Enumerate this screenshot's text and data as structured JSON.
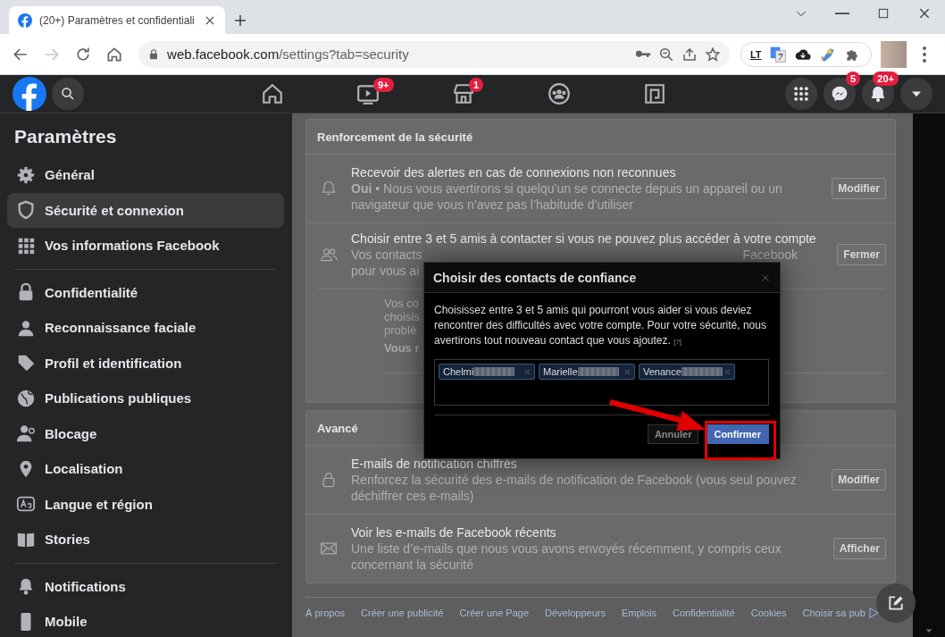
{
  "browser": {
    "tab": {
      "title": "(20+) Paramètres et confidentiali",
      "selected": true
    },
    "url": {
      "host": "web.facebook.com",
      "path": "/settings?tab=security"
    },
    "forward_disabled": true,
    "extensions": [
      {
        "kind": "languagetool",
        "label": "LT"
      },
      {
        "kind": "translate"
      },
      {
        "kind": "cloud"
      },
      {
        "kind": "rocket"
      },
      {
        "kind": "puzzle"
      }
    ]
  },
  "nav": {
    "center": [
      {
        "kind": "home"
      },
      {
        "kind": "watch",
        "badge": "9+"
      },
      {
        "kind": "marketplace",
        "badge": "1"
      },
      {
        "kind": "groups"
      },
      {
        "kind": "gaming"
      }
    ],
    "right": [
      {
        "kind": "apps"
      },
      {
        "kind": "messenger",
        "badge": "5"
      },
      {
        "kind": "notifications",
        "badge": "20+"
      },
      {
        "kind": "account"
      }
    ]
  },
  "sidebar": {
    "title": "Paramètres",
    "groups": [
      [
        {
          "kind": "gear",
          "label": "Général",
          "selected": false
        },
        {
          "kind": "shield",
          "label": "Sécurité et connexion",
          "selected": true
        },
        {
          "kind": "grid",
          "label": "Vos informations Facebook",
          "selected": false
        }
      ],
      [
        {
          "kind": "lock",
          "label": "Confidentialité",
          "selected": false
        },
        {
          "kind": "face",
          "label": "Reconnaissance faciale",
          "selected": false
        },
        {
          "kind": "tag",
          "label": "Profil et identification",
          "selected": false
        },
        {
          "kind": "globe",
          "label": "Publications publiques",
          "selected": false
        },
        {
          "kind": "block",
          "label": "Blocage",
          "selected": false
        },
        {
          "kind": "pin",
          "label": "Localisation",
          "selected": false
        },
        {
          "kind": "text",
          "label": "Langue et région",
          "selected": false
        },
        {
          "kind": "book",
          "label": "Stories",
          "selected": false
        }
      ],
      [
        {
          "kind": "bell",
          "label": "Notifications",
          "selected": false
        },
        {
          "kind": "phone",
          "label": "Mobile",
          "selected": false
        }
      ]
    ]
  },
  "sections": [
    {
      "title": "Renforcement de la sécurité",
      "rows": [
        {
          "kind": "bell",
          "title": "Recevoir des alertes en cas de connexions non reconnues",
          "description": "**Oui** • Nous vous avertirons si quelqu’un se connecte depuis un appareil ou un navigateur que vous n’avez pas l’habitude d’utiliser",
          "button": "Modifier"
        },
        {
          "kind": "people",
          "title": "Choisir entre 3 et 5 amis à contacter si vous ne pouvez plus accéder à votre compte",
          "description_lines": [
            {
              "left": "Vos contacts",
              "right": "Facebook"
            },
            {
              "left": "pour vous ai"
            }
          ],
          "button": "Fermer",
          "detail_lines": [
            "Vos co",
            "choisis",
            "problè"
          ],
          "detail_bold": "Vous r"
        }
      ]
    },
    {
      "title": "Avancé",
      "rows": [
        {
          "kind": "lock",
          "title": "E-mails de notification chiffrés",
          "description": "Renforcez la sécurité des e-mails de notification de Facebook (vous seul pouvez déchiffrer ces e-mails)",
          "button": "Modifier"
        },
        {
          "kind": "mail",
          "title": "Voir les e-mails de Facebook récents",
          "description": "Une liste d’e-mails que nous vous avons envoyés récemment, y compris ceux concernant la sécurité",
          "button": "Afficher"
        }
      ]
    }
  ],
  "footer_links": [
    "À propos",
    "Créer une publicité",
    "Créer une Page",
    "Développeurs",
    "Emplois",
    "Confidentialité",
    "Cookies",
    "Choisir sa pub"
  ],
  "modal": {
    "title": "Choisir des contacts de confiance",
    "body": "Choisissez entre 3 et 5 amis qui pourront vous aider si vous deviez rencontrer des difficultés avec votre compte. Pour votre sécurité, nous avertirons tout nouveau contact que vous ajoutez.",
    "help": "[?]",
    "contacts": [
      "Chelmi",
      "Marielle",
      "Venance"
    ],
    "buttons": [
      {
        "kind": "cancel",
        "label": "Annuler"
      },
      {
        "kind": "confirm",
        "label": "Confirmer"
      }
    ]
  },
  "annotation": {
    "kind": "arrow-box"
  }
}
